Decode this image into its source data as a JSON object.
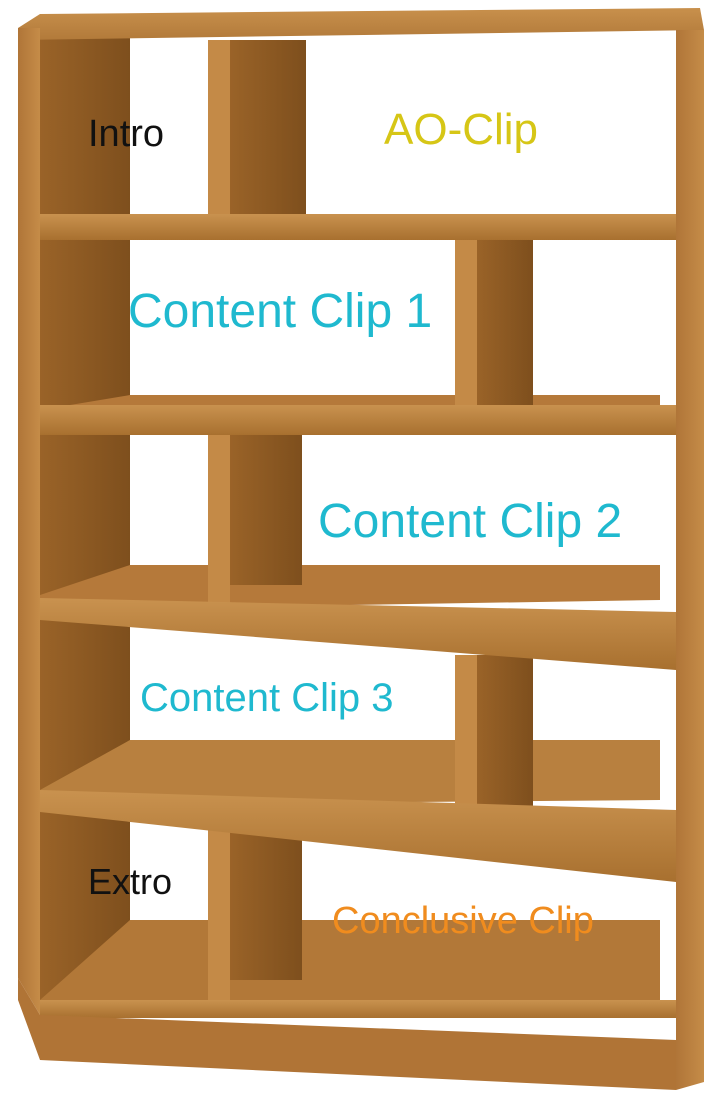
{
  "labels": {
    "intro": "Intro",
    "ao_clip": "AO-Clip",
    "content_clip_1": "Content Clip 1",
    "content_clip_2": "Content Clip 2",
    "content_clip_3": "Content Clip 3",
    "extro": "Extro",
    "conclusive_clip": "Conclusive Clip"
  },
  "colors": {
    "intro": "#111111",
    "ao_clip": "#d6c616",
    "content_clip_1": "#1fb9cf",
    "content_clip_2": "#1fb9cf",
    "content_clip_3": "#1fb9cf",
    "extro": "#111111",
    "conclusive_clip": "#f08c1e"
  }
}
